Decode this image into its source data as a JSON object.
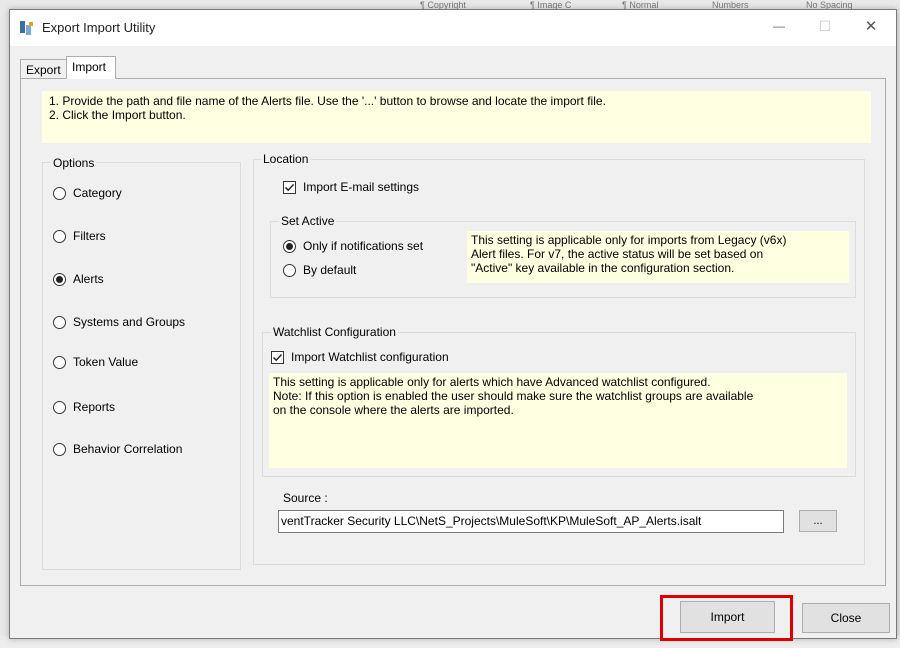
{
  "background_strip": [
    "¶ Copyright",
    "¶ Image C",
    "¶ Normal",
    "Numbers",
    "No Spacing"
  ],
  "window": {
    "title": "Export Import Utility",
    "controls": {
      "minimize": "—",
      "maximize": "☐",
      "close": "✕"
    }
  },
  "tabs": [
    {
      "label": "Export",
      "active": false
    },
    {
      "label": "Import",
      "active": true
    }
  ],
  "instructions": [
    "1. Provide the path and file name of the Alerts file. Use the '...' button to browse and locate the import file.",
    "2. Click the Import button."
  ],
  "options": {
    "title": "Options",
    "selected": "Alerts",
    "items": [
      {
        "label": "Category",
        "selected": false
      },
      {
        "label": "Filters",
        "selected": false
      },
      {
        "label": "Alerts",
        "selected": true
      },
      {
        "label": "Systems and Groups",
        "selected": false
      },
      {
        "label": "Token Value",
        "selected": false
      },
      {
        "label": "Reports",
        "selected": false
      },
      {
        "label": "Behavior Correlation",
        "selected": false
      }
    ]
  },
  "location": {
    "title": "Location",
    "import_email": {
      "label": "Import E-mail settings",
      "checked": true
    },
    "set_active": {
      "title": "Set Active",
      "options": [
        {
          "label": "Only if notifications set",
          "selected": true
        },
        {
          "label": "By default",
          "selected": false
        }
      ],
      "note": [
        "This setting is applicable only for imports from Legacy (v6x)",
        "Alert files. For v7, the active status will be set based on",
        "\"Active\" key available in the configuration section."
      ]
    },
    "watchlist": {
      "title": "Watchlist Configuration",
      "import_watchlist": {
        "label": "Import Watchlist configuration",
        "checked": true
      },
      "note": [
        "This setting is applicable only for alerts which have Advanced watchlist configured.",
        "Note: If this option is enabled the user should make sure the watchlist groups are available",
        "on the console where the alerts are imported."
      ]
    },
    "source": {
      "label": "Source :",
      "value": "ventTracker Security LLC\\NetS_Projects\\MuleSoft\\KP\\MuleSoft_AP_Alerts.isalt",
      "browse_label": "..."
    }
  },
  "footer": {
    "import_label": "Import",
    "close_label": "Close",
    "highlight_color": "#e00000"
  }
}
